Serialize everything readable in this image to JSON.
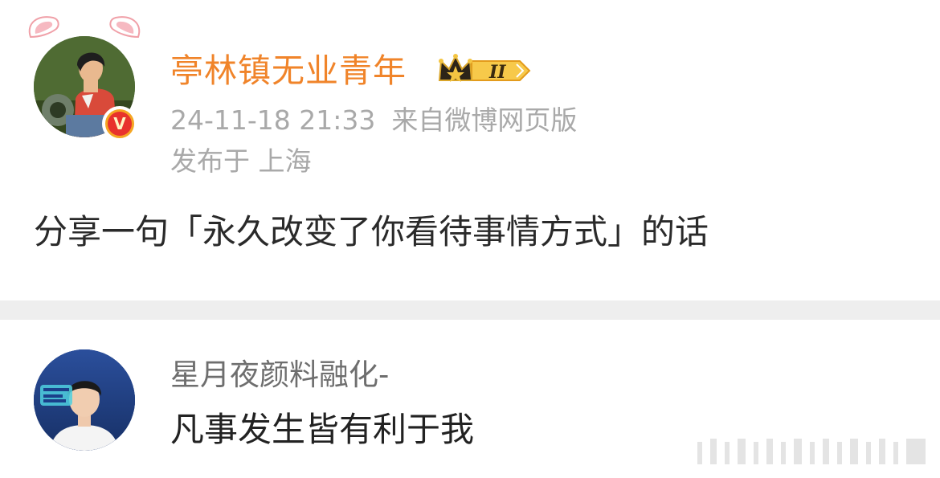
{
  "post": {
    "username": "亭林镇无业青年",
    "member_level": "II",
    "timestamp": "24-11-18 21:33",
    "source": "来自微博网页版",
    "location": "发布于 上海",
    "text": "分享一句「永久改变了你看待事情方式」的话",
    "verified_badge": "V",
    "avatar_icon": "illustrated-man-avatar",
    "decoration_icon": "bunny-ears-icon",
    "badge_icon": "crown-member-badge-icon"
  },
  "comment": {
    "username": "星月夜颜料融化-",
    "text": "凡事发生皆有利于我",
    "avatar_icon": "young-man-avatar"
  },
  "colors": {
    "username": "#f0842a",
    "meta": "#a9a9a9",
    "text": "#2a2a2a",
    "divider": "#eeeeee",
    "verified_outer": "#f5a623",
    "verified_inner": "#e8322c"
  }
}
